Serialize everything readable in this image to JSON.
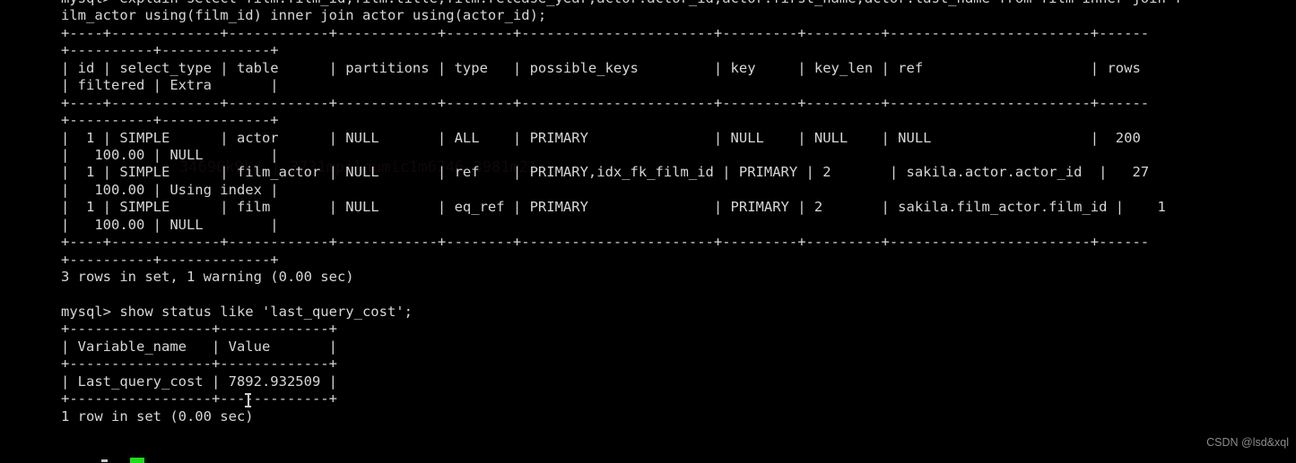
{
  "terminal": {
    "prompt": "mysql>",
    "background_color": "#000000",
    "text_color": "#d6d6d6",
    "cursor_color": "#19e019",
    "lines": [
      "mysql> explain select film.film_id,film.title,film.release_year,actor.actor_id,actor.first_name,actor.last_name from film inner join f",
      "ilm_actor using(film_id) inner join actor using(actor_id);",
      "+----+-------------+------------+------------+--------+-----------------------+---------+---------+------------------------+------",
      "+----------+-------------+",
      "| id | select_type | table      | partitions | type   | possible_keys         | key     | key_len | ref                    | rows",
      "| filtered | Extra       |",
      "+----+-------------+------------+------------+--------+-----------------------+---------+---------+------------------------+------",
      "+----------+-------------+",
      "|  1 | SIMPLE      | actor      | NULL       | ALL    | PRIMARY               | NULL    | NULL    | NULL                   |  200",
      "|   100.00 | NULL        |",
      "|  1 | SIMPLE      | film_actor | NULL       | ref    | PRIMARY,idx_fk_film_id | PRIMARY | 2       | sakila.actor.actor_id  |   27",
      "|   100.00 | Using index |",
      "|  1 | SIMPLE      | film       | NULL       | eq_ref | PRIMARY               | PRIMARY | 2       | sakila.film_actor.film_id |    1",
      "|   100.00 | NULL        |",
      "+----+-------------+------------+------------+--------+-----------------------+---------+---------+------------------------+------",
      "+----------+-------------+",
      "3 rows in set, 1 warning (0.00 sec)",
      "",
      "mysql> show status like 'last_query_cost';",
      "+-----------------+-------------+",
      "| Variable_name   | Value       |",
      "+-----------------+-------------+",
      "| Last_query_cost | 7892.932509 |",
      "+-----------------+-------------+",
      "1 row in set (0.00 sec)",
      ""
    ]
  },
  "explain_query": {
    "statement": "explain select film.film_id,film.title,film.release_year,actor.actor_id,actor.first_name,actor.last_name from film inner join film_actor using(film_id) inner join actor using(actor_id);",
    "columns": [
      "id",
      "select_type",
      "table",
      "partitions",
      "type",
      "possible_keys",
      "key",
      "key_len",
      "ref",
      "rows",
      "filtered",
      "Extra"
    ],
    "rows": [
      {
        "id": "1",
        "select_type": "SIMPLE",
        "table": "actor",
        "partitions": "NULL",
        "type": "ALL",
        "possible_keys": "PRIMARY",
        "key": "NULL",
        "key_len": "NULL",
        "ref": "NULL",
        "rows": "200",
        "filtered": "100.00",
        "Extra": "NULL"
      },
      {
        "id": "1",
        "select_type": "SIMPLE",
        "table": "film_actor",
        "partitions": "NULL",
        "type": "ref",
        "possible_keys": "PRIMARY,idx_fk_film_id",
        "key": "PRIMARY",
        "key_len": "2",
        "ref": "sakila.actor.actor_id",
        "rows": "27",
        "filtered": "100.00",
        "Extra": "Using index"
      },
      {
        "id": "1",
        "select_type": "SIMPLE",
        "table": "film",
        "partitions": "NULL",
        "type": "eq_ref",
        "possible_keys": "PRIMARY",
        "key": "PRIMARY",
        "key_len": "2",
        "ref": "sakila.film_actor.film_id",
        "rows": "1",
        "filtered": "100.00",
        "Extra": "NULL"
      }
    ],
    "result_status": "3 rows in set, 1 warning (0.00 sec)"
  },
  "status_query": {
    "statement": "show status like 'last_query_cost';",
    "columns": [
      "Variable_name",
      "Value"
    ],
    "rows": [
      {
        "Variable_name": "Last_query_cost",
        "Value": "7892.932509"
      }
    ],
    "result_status": "1 row in set (0.00 sec)"
  },
  "watermark": {
    "corner_text": "CSDN @lsd&xql",
    "background_text": "34696k9kd | 3731mpildumic1m6746-3981m21"
  }
}
